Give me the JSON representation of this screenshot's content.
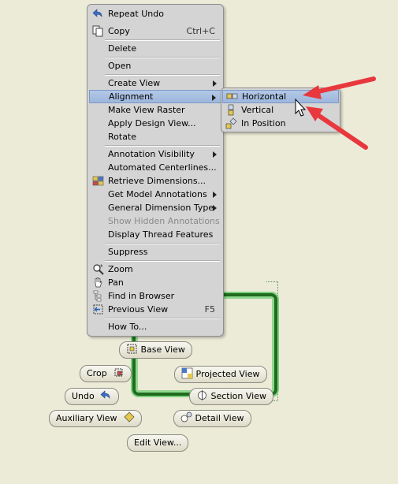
{
  "context_menu": {
    "items": [
      {
        "label": "Repeat Undo",
        "icon": "undo-icon"
      },
      {
        "label": "Copy",
        "shortcut": "Ctrl+C",
        "icon": "copy-icon"
      },
      {
        "label": "Delete"
      },
      {
        "label": "Open"
      },
      {
        "label": "Create View"
      },
      {
        "label": "Alignment"
      },
      {
        "label": "Make View Raster"
      },
      {
        "label": "Apply Design View..."
      },
      {
        "label": "Rotate"
      },
      {
        "label": "Annotation Visibility"
      },
      {
        "label": "Automated Centerlines..."
      },
      {
        "label": "Retrieve Dimensions...",
        "icon": "retrieve-dimensions-icon"
      },
      {
        "label": "Get Model Annotations"
      },
      {
        "label": "General Dimension Type"
      },
      {
        "label": "Show Hidden Annotations"
      },
      {
        "label": "Display Thread Features"
      },
      {
        "label": "Suppress"
      },
      {
        "label": "Zoom",
        "icon": "zoom-icon"
      },
      {
        "label": "Pan",
        "icon": "pan-hand-icon"
      },
      {
        "label": "Find in Browser",
        "icon": "find-in-browser-icon"
      },
      {
        "label": "Previous View",
        "shortcut": "F5",
        "icon": "previous-view-icon"
      },
      {
        "label": "How To..."
      }
    ]
  },
  "submenu": {
    "items": [
      {
        "label": "Horizontal",
        "icon": "align-horizontal-icon"
      },
      {
        "label": "Vertical",
        "icon": "align-vertical-icon"
      },
      {
        "label": "In Position",
        "icon": "align-in-position-icon"
      }
    ]
  },
  "marking_menu": {
    "base_view": "Base View",
    "crop": "Crop",
    "projected_view": "Projected View",
    "undo": "Undo",
    "section_view": "Section View",
    "auxiliary_view": "Auxiliary View",
    "detail_view": "Detail View",
    "edit_view": "Edit View..."
  },
  "colors": {
    "background": "#ecebd8",
    "menu": "#d4d4d4",
    "selection": "#9db6dc",
    "annotation_arrow": "#e8383d",
    "view_frame": "#1f6b1f"
  }
}
